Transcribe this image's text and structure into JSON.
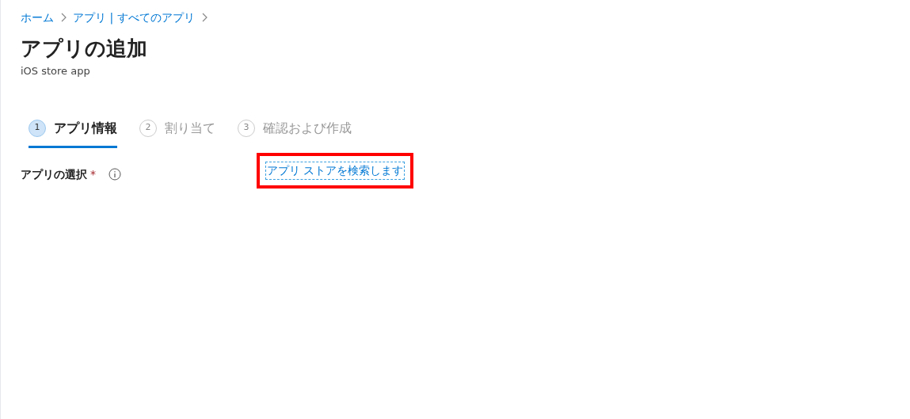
{
  "breadcrumb": [
    {
      "label": "ホーム"
    },
    {
      "label": "アプリ | すべてのアプリ"
    }
  ],
  "title": "アプリの追加",
  "subtitle": "iOS store app",
  "steps": [
    {
      "number": "1",
      "label": "アプリ情報",
      "selected": true
    },
    {
      "number": "2",
      "label": "割り当て",
      "selected": false
    },
    {
      "number": "3",
      "label": "確認および作成",
      "selected": false
    }
  ],
  "field": {
    "label": "アプリの選択",
    "required_mark": "*",
    "link": "アプリ ストアを検索します",
    "highlighted": true
  }
}
